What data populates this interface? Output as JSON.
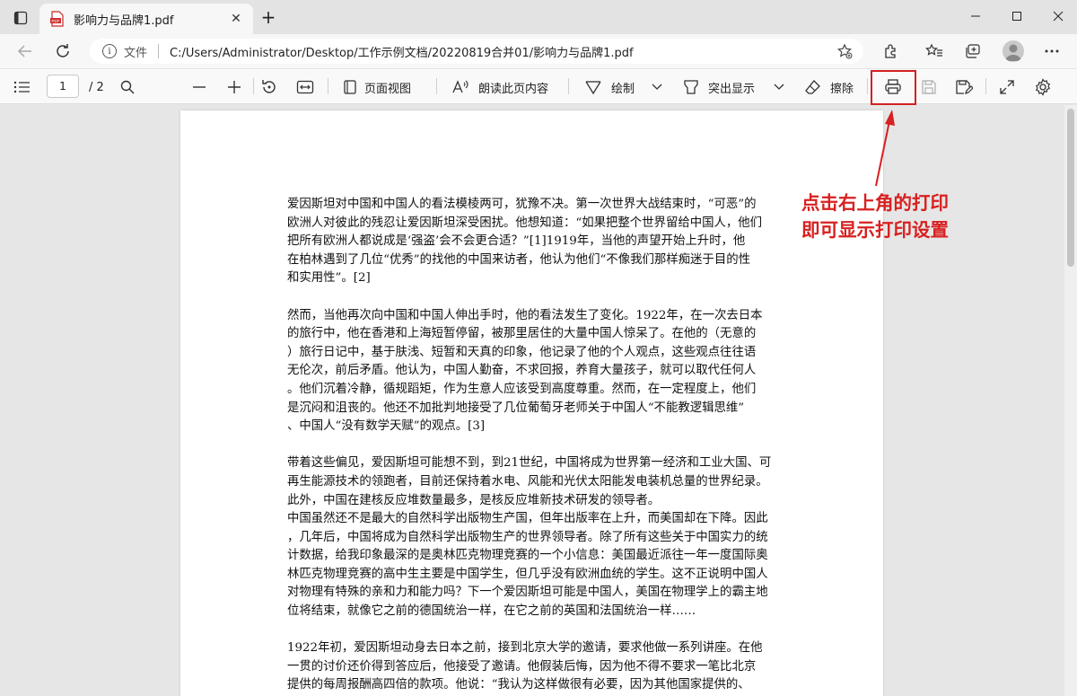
{
  "browser": {
    "tab": {
      "title": "影响力与品牌1.pdf"
    },
    "address": {
      "scheme_label": "文件",
      "url": "C:/Users/Administrator/Desktop/工作示例文档/20220819合并01/影响力与品牌1.pdf"
    }
  },
  "pdf_toolbar": {
    "page_current": "1",
    "page_total": "/ 2",
    "page_view_label": "页面视图",
    "read_aloud_label": "朗读此页内容",
    "draw_label": "绘制",
    "highlight_label": "突出显示",
    "erase_label": "擦除"
  },
  "document": {
    "paragraphs": [
      {
        "lines": [
          "爱因斯坦对中国和中国人的看法模棱两可，犹豫不决。第一次世界大战结束时，“可恶”的",
          "欧洲人对彼此的残忍让爱因斯坦深受困扰。他想知道：“如果把整个世界留给中国人，他们",
          "把所有欧洲人都说成是‘强盗’会不会更合适？”[1]1919年，当他的声望开始上升时，他",
          "在柏林遇到了几位“优秀”的找他的中国来访者，他认为他们“不像我们那样痴迷于目的性",
          "和实用性”。[2]"
        ]
      },
      {
        "lines": [
          "然而，当他再次向中国和中国人伸出手时，他的看法发生了变化。1922年，在一次去日本",
          "的旅行中，他在香港和上海短暂停留，被那里居住的大量中国人惊呆了。在他的（无意的",
          "）旅行日记中，基于肤浅、短暂和天真的印象，他记录了他的个人观点，这些观点往往语",
          "无伦次，前后矛盾。他认为，中国人勤奋，不求回报，养育大量孩子，就可以取代任何人",
          "。他们沉着冷静，循规蹈矩，作为生意人应该受到高度尊重。然而，在一定程度上，他们",
          "是沉闷和沮丧的。他还不加批判地接受了几位葡萄牙老师关于中国人“不能教逻辑思维”",
          "、中国人“没有数学天赋”的观点。[3]"
        ]
      },
      {
        "lines": [
          "带着这些偏见，爱因斯坦可能想不到，到21世纪，中国将成为世界第一经济和工业大国、可",
          "再生能源技术的领跑者，目前还保持着水电、风能和光伏太阳能发电装机总量的世界纪录。",
          "此外，中国在建核反应堆数量最多，是核反应堆新技术研发的领导者。",
          "中国虽然还不是最大的自然科学出版物生产国，但年出版率在上升，而美国却在下降。因此",
          "，几年后，中国将成为自然科学出版物生产的世界领导者。除了所有这些关于中国实力的统",
          "计数据，给我印象最深的是奥林匹克物理竞赛的一个小信息：美国最近派往一年一度国际奥",
          "林匹克物理竞赛的高中生主要是中国学生，但几乎没有欧洲血统的学生。这不正说明中国人",
          "对物理有特殊的亲和力和能力吗？下一个爱因斯坦可能是中国人，美国在物理学上的霸主地",
          "位将结束，就像它之前的德国统治一样，在它之前的英国和法国统治一样……"
        ]
      },
      {
        "lines": [
          "1922年初，爱因斯坦动身去日本之前，接到北京大学的邀请，要求他做一系列讲座。在他",
          "一贯的讨价还价得到答应后，他接受了邀请。他假装后悔，因为他不得不要求一笔比北京",
          "提供的每周报酬高四倍的款项。他说：“我认为这样做很有必要，因为其他国家提供的、"
        ]
      }
    ]
  },
  "annotation": {
    "lines": [
      "点击右上角的打印",
      "即可显示打印设置"
    ],
    "color": "#d82020"
  }
}
